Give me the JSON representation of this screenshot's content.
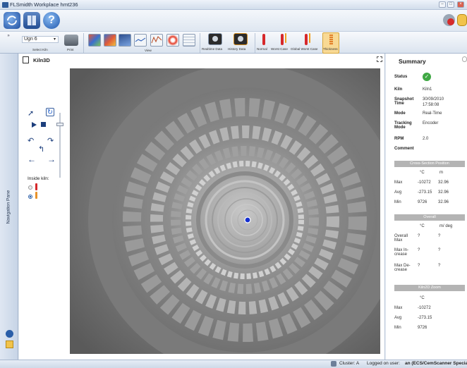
{
  "window": {
    "title": "FLSmidth Workplace hmt236"
  },
  "ribbon": {
    "kiln_select_value": "Ugn 6",
    "select_kiln_label": "Select Kiln",
    "print_label": "Print",
    "view_group_label": "View",
    "realtime_label": "Realtime Data",
    "history_label": "History Data",
    "normal_label": "Normal",
    "worst_case_label": "Worst Case",
    "global_worst_case_label": "Global Worst Case",
    "thickness_label": "Thickness"
  },
  "nav_pane": {
    "label": "Navigation Pane"
  },
  "document": {
    "tab_title": "Kiln3D",
    "inside_kiln_label": "Inside kiln:"
  },
  "summary": {
    "title": "Summary",
    "status_label": "Status",
    "kiln_label": "Kiln",
    "kiln_value": "Kiln1",
    "snapshot_label": "Snapshot Time",
    "snapshot_date": "30/09/2010",
    "snapshot_time": "17:58:08",
    "mode_label": "Mode",
    "mode_value": "Real-Time",
    "tracking_label": "Tracking Mode",
    "tracking_value": "Encoder",
    "rpm_label": "RPM",
    "rpm_value": "2.0",
    "comment_label": "Comment",
    "cross_section": {
      "header": "Cross-Section Position",
      "col1": "°C",
      "col2": "m",
      "rows": [
        {
          "label": "Max",
          "c": "-10272",
          "m": "32.96"
        },
        {
          "label": "Avg",
          "c": "-273.15",
          "m": "32.96"
        },
        {
          "label": "Min",
          "c": "9726",
          "m": "32.96"
        }
      ]
    },
    "overall": {
      "header": "Overall",
      "col1": "°C",
      "col2": "m/ deg",
      "rows": [
        {
          "label": "Overall Max",
          "c": "?",
          "m": "?"
        },
        {
          "label": "Max In- crease",
          "c": "?",
          "m": "?"
        },
        {
          "label": "Max De- crease",
          "c": "?",
          "m": "?"
        }
      ]
    },
    "zoom": {
      "header": "Kiln2D Zoom",
      "col1": "°C",
      "rows": [
        {
          "label": "Max",
          "c": "-10272"
        },
        {
          "label": "Avg",
          "c": "-273.15"
        },
        {
          "label": "Min",
          "c": "9726"
        }
      ]
    }
  },
  "statusbar": {
    "cluster_label": "Cluster: A",
    "logged_on_label": "Logged on user:",
    "user_value": "an (ECS/CemScanner Specialist)"
  },
  "colors": {
    "accent": "#1e55b0",
    "status_ok": "#3fa844",
    "blue_point": "#1530d0"
  }
}
